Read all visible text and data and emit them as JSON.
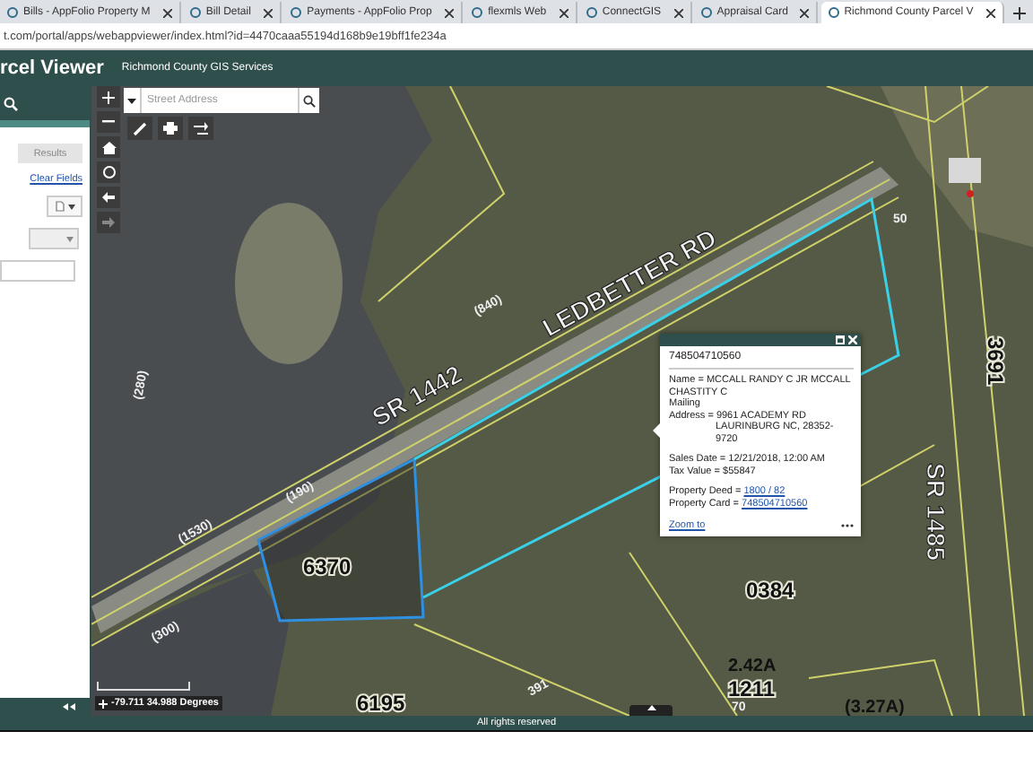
{
  "browser": {
    "tabs": [
      {
        "label": "Bills - AppFolio Property M",
        "selected": false
      },
      {
        "label": "Bill Detail",
        "selected": false
      },
      {
        "label": "Payments - AppFolio Prop",
        "selected": false
      },
      {
        "label": "flexmls Web",
        "selected": false
      },
      {
        "label": "ConnectGIS",
        "selected": false
      },
      {
        "label": "Appraisal Card",
        "selected": false
      },
      {
        "label": "Richmond County Parcel V",
        "selected": true
      }
    ],
    "url": "t.com/portal/apps/webappviewer/index.html?id=4470caaa55194d168b9e19bff1fe234a"
  },
  "app": {
    "title": "rcel Viewer",
    "subtitle": "Richmond County GIS Services"
  },
  "panel": {
    "results_button": "Results",
    "clear_link": "Clear Fields"
  },
  "search": {
    "placeholder": "Street Address"
  },
  "map": {
    "labels": [
      {
        "text": "LEDBETTER RD",
        "kind": "road"
      },
      {
        "text": "SR 1442",
        "kind": "road"
      },
      {
        "text": "(840)",
        "kind": "dim"
      },
      {
        "text": "(190)",
        "kind": "dim"
      },
      {
        "text": "(1530)",
        "kind": "dim"
      },
      {
        "text": "(280)",
        "kind": "dim"
      },
      {
        "text": "(300)",
        "kind": "dim"
      },
      {
        "text": "6370",
        "kind": "parcel"
      },
      {
        "text": "0384",
        "kind": "parcel"
      },
      {
        "text": "6195",
        "kind": "parcel"
      },
      {
        "text": "2.42A",
        "kind": "acre"
      },
      {
        "text": "1211",
        "kind": "parcel"
      },
      {
        "text": "70",
        "kind": "dim"
      },
      {
        "text": "391",
        "kind": "dim"
      },
      {
        "text": "(3.27A)",
        "kind": "acre"
      },
      {
        "text": "50",
        "kind": "dim"
      },
      {
        "text": "3691",
        "kind": "parcel"
      },
      {
        "text": "SR 1485",
        "kind": "road"
      }
    ]
  },
  "popup": {
    "title": "748504710560",
    "lines": [
      {
        "text": "Name = MCCALL RANDY C JR MCCALL CHASTITY C",
        "kind": "text"
      },
      {
        "text": "Mailing",
        "kind": "text"
      },
      {
        "text": "Address = 9961 ACADEMY RD",
        "kind": "text"
      },
      {
        "text": "LAURINBURG  NC, 28352-9720",
        "kind": "indent"
      },
      {
        "text": "Sales Date = 12/21/2018, 12:00 AM",
        "kind": "gap"
      },
      {
        "text": "Tax Value = $55847",
        "kind": "text"
      },
      {
        "text": "Property Deed = ",
        "link": "1800 / 82",
        "kind": "gap"
      },
      {
        "text": "Property Card = ",
        "link": "748504710560",
        "kind": "text"
      }
    ],
    "zoom_link": "Zoom to"
  },
  "coordinates": "-79.711 34.988 Degrees",
  "footer": "All rights reserved"
}
